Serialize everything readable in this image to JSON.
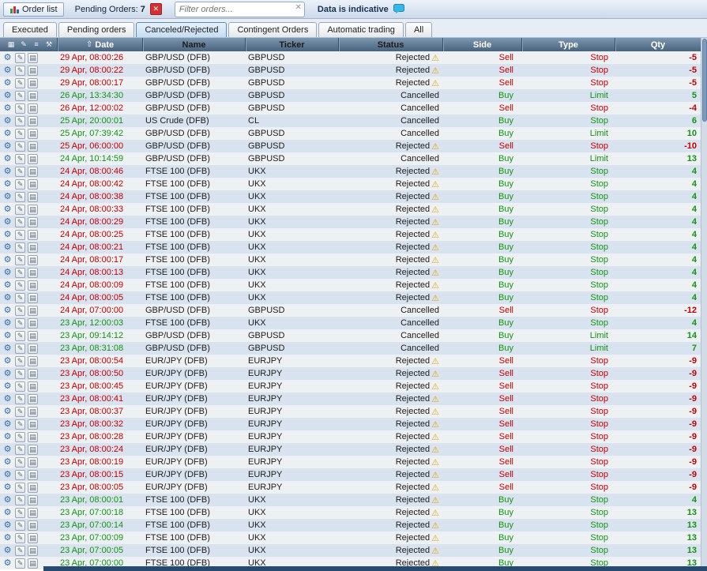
{
  "toolbar": {
    "order_list_label": "Order list",
    "pending_orders_label": "Pending Orders:",
    "pending_orders_count": "7",
    "filter_placeholder": "Filter orders...",
    "indicative_label": "Data is indicative"
  },
  "icons": {
    "close": "✕",
    "clear": "✕",
    "window": "▦",
    "edit": "✎",
    "list": "≡",
    "wrench": "⚒",
    "sort_asc": "⇧",
    "warning": "⚠",
    "settings": "⚙",
    "details": "▤"
  },
  "colors": {
    "red": "#c40000",
    "green": "#149314",
    "neutral": "#1c1c1c"
  },
  "tabs": [
    {
      "label": "Executed",
      "active": false
    },
    {
      "label": "Pending orders",
      "active": false
    },
    {
      "label": "Canceled/Rejected",
      "active": true
    },
    {
      "label": "Contingent Orders",
      "active": false
    },
    {
      "label": "Automatic trading",
      "active": false
    },
    {
      "label": "All",
      "active": false
    }
  ],
  "table": {
    "columns": {
      "date": "Date",
      "name": "Name",
      "ticker": "Ticker",
      "status": "Status",
      "side": "Side",
      "type": "Type",
      "qty": "Qty"
    },
    "rows": [
      {
        "date": "29 Apr, 08:00:26",
        "name": "GBP/USD (DFB)",
        "ticker": "GBPUSD",
        "status": "Rejected",
        "warning": true,
        "side": "Sell",
        "type": "Stop",
        "qty": "-5",
        "date_color": "red"
      },
      {
        "date": "29 Apr, 08:00:22",
        "name": "GBP/USD (DFB)",
        "ticker": "GBPUSD",
        "status": "Rejected",
        "warning": true,
        "side": "Sell",
        "type": "Stop",
        "qty": "-5",
        "date_color": "red"
      },
      {
        "date": "29 Apr, 08:00:17",
        "name": "GBP/USD (DFB)",
        "ticker": "GBPUSD",
        "status": "Rejected",
        "warning": true,
        "side": "Sell",
        "type": "Stop",
        "qty": "-5",
        "date_color": "red"
      },
      {
        "date": "26 Apr, 13:34:30",
        "name": "GBP/USD (DFB)",
        "ticker": "GBPUSD",
        "status": "Cancelled",
        "warning": false,
        "side": "Buy",
        "type": "Limit",
        "qty": "5",
        "date_color": "green"
      },
      {
        "date": "26 Apr, 12:00:02",
        "name": "GBP/USD (DFB)",
        "ticker": "GBPUSD",
        "status": "Cancelled",
        "warning": false,
        "side": "Sell",
        "type": "Stop",
        "qty": "-4",
        "date_color": "red"
      },
      {
        "date": "25 Apr, 20:00:01",
        "name": "US Crude (DFB)",
        "ticker": "CL",
        "status": "Cancelled",
        "warning": false,
        "side": "Buy",
        "type": "Stop",
        "qty": "6",
        "date_color": "green"
      },
      {
        "date": "25 Apr, 07:39:42",
        "name": "GBP/USD (DFB)",
        "ticker": "GBPUSD",
        "status": "Cancelled",
        "warning": false,
        "side": "Buy",
        "type": "Limit",
        "qty": "10",
        "date_color": "green"
      },
      {
        "date": "25 Apr, 06:00:00",
        "name": "GBP/USD (DFB)",
        "ticker": "GBPUSD",
        "status": "Rejected",
        "warning": true,
        "side": "Sell",
        "type": "Stop",
        "qty": "-10",
        "date_color": "red"
      },
      {
        "date": "24 Apr, 10:14:59",
        "name": "GBP/USD (DFB)",
        "ticker": "GBPUSD",
        "status": "Cancelled",
        "warning": false,
        "side": "Buy",
        "type": "Limit",
        "qty": "13",
        "date_color": "green"
      },
      {
        "date": "24 Apr, 08:00:46",
        "name": "FTSE 100 (DFB)",
        "ticker": "UKX",
        "status": "Rejected",
        "warning": true,
        "side": "Buy",
        "type": "Stop",
        "qty": "4",
        "date_color": "red"
      },
      {
        "date": "24 Apr, 08:00:42",
        "name": "FTSE 100 (DFB)",
        "ticker": "UKX",
        "status": "Rejected",
        "warning": true,
        "side": "Buy",
        "type": "Stop",
        "qty": "4",
        "date_color": "red"
      },
      {
        "date": "24 Apr, 08:00:38",
        "name": "FTSE 100 (DFB)",
        "ticker": "UKX",
        "status": "Rejected",
        "warning": true,
        "side": "Buy",
        "type": "Stop",
        "qty": "4",
        "date_color": "red"
      },
      {
        "date": "24 Apr, 08:00:33",
        "name": "FTSE 100 (DFB)",
        "ticker": "UKX",
        "status": "Rejected",
        "warning": true,
        "side": "Buy",
        "type": "Stop",
        "qty": "4",
        "date_color": "red"
      },
      {
        "date": "24 Apr, 08:00:29",
        "name": "FTSE 100 (DFB)",
        "ticker": "UKX",
        "status": "Rejected",
        "warning": true,
        "side": "Buy",
        "type": "Stop",
        "qty": "4",
        "date_color": "red"
      },
      {
        "date": "24 Apr, 08:00:25",
        "name": "FTSE 100 (DFB)",
        "ticker": "UKX",
        "status": "Rejected",
        "warning": true,
        "side": "Buy",
        "type": "Stop",
        "qty": "4",
        "date_color": "red"
      },
      {
        "date": "24 Apr, 08:00:21",
        "name": "FTSE 100 (DFB)",
        "ticker": "UKX",
        "status": "Rejected",
        "warning": true,
        "side": "Buy",
        "type": "Stop",
        "qty": "4",
        "date_color": "red"
      },
      {
        "date": "24 Apr, 08:00:17",
        "name": "FTSE 100 (DFB)",
        "ticker": "UKX",
        "status": "Rejected",
        "warning": true,
        "side": "Buy",
        "type": "Stop",
        "qty": "4",
        "date_color": "red"
      },
      {
        "date": "24 Apr, 08:00:13",
        "name": "FTSE 100 (DFB)",
        "ticker": "UKX",
        "status": "Rejected",
        "warning": true,
        "side": "Buy",
        "type": "Stop",
        "qty": "4",
        "date_color": "red"
      },
      {
        "date": "24 Apr, 08:00:09",
        "name": "FTSE 100 (DFB)",
        "ticker": "UKX",
        "status": "Rejected",
        "warning": true,
        "side": "Buy",
        "type": "Stop",
        "qty": "4",
        "date_color": "red"
      },
      {
        "date": "24 Apr, 08:00:05",
        "name": "FTSE 100 (DFB)",
        "ticker": "UKX",
        "status": "Rejected",
        "warning": true,
        "side": "Buy",
        "type": "Stop",
        "qty": "4",
        "date_color": "red"
      },
      {
        "date": "24 Apr, 07:00:00",
        "name": "GBP/USD (DFB)",
        "ticker": "GBPUSD",
        "status": "Cancelled",
        "warning": false,
        "side": "Sell",
        "type": "Stop",
        "qty": "-12",
        "date_color": "red"
      },
      {
        "date": "23 Apr, 12:00:03",
        "name": "FTSE 100 (DFB)",
        "ticker": "UKX",
        "status": "Cancelled",
        "warning": false,
        "side": "Buy",
        "type": "Stop",
        "qty": "4",
        "date_color": "green"
      },
      {
        "date": "23 Apr, 09:14:12",
        "name": "GBP/USD (DFB)",
        "ticker": "GBPUSD",
        "status": "Cancelled",
        "warning": false,
        "side": "Buy",
        "type": "Limit",
        "qty": "14",
        "date_color": "green"
      },
      {
        "date": "23 Apr, 08:31:08",
        "name": "GBP/USD (DFB)",
        "ticker": "GBPUSD",
        "status": "Cancelled",
        "warning": false,
        "side": "Buy",
        "type": "Limit",
        "qty": "7",
        "date_color": "green"
      },
      {
        "date": "23 Apr, 08:00:54",
        "name": "EUR/JPY (DFB)",
        "ticker": "EURJPY",
        "status": "Rejected",
        "warning": true,
        "side": "Sell",
        "type": "Stop",
        "qty": "-9",
        "date_color": "red"
      },
      {
        "date": "23 Apr, 08:00:50",
        "name": "EUR/JPY (DFB)",
        "ticker": "EURJPY",
        "status": "Rejected",
        "warning": true,
        "side": "Sell",
        "type": "Stop",
        "qty": "-9",
        "date_color": "red"
      },
      {
        "date": "23 Apr, 08:00:45",
        "name": "EUR/JPY (DFB)",
        "ticker": "EURJPY",
        "status": "Rejected",
        "warning": true,
        "side": "Sell",
        "type": "Stop",
        "qty": "-9",
        "date_color": "red"
      },
      {
        "date": "23 Apr, 08:00:41",
        "name": "EUR/JPY (DFB)",
        "ticker": "EURJPY",
        "status": "Rejected",
        "warning": true,
        "side": "Sell",
        "type": "Stop",
        "qty": "-9",
        "date_color": "red"
      },
      {
        "date": "23 Apr, 08:00:37",
        "name": "EUR/JPY (DFB)",
        "ticker": "EURJPY",
        "status": "Rejected",
        "warning": true,
        "side": "Sell",
        "type": "Stop",
        "qty": "-9",
        "date_color": "red"
      },
      {
        "date": "23 Apr, 08:00:32",
        "name": "EUR/JPY (DFB)",
        "ticker": "EURJPY",
        "status": "Rejected",
        "warning": true,
        "side": "Sell",
        "type": "Stop",
        "qty": "-9",
        "date_color": "red"
      },
      {
        "date": "23 Apr, 08:00:28",
        "name": "EUR/JPY (DFB)",
        "ticker": "EURJPY",
        "status": "Rejected",
        "warning": true,
        "side": "Sell",
        "type": "Stop",
        "qty": "-9",
        "date_color": "red"
      },
      {
        "date": "23 Apr, 08:00:24",
        "name": "EUR/JPY (DFB)",
        "ticker": "EURJPY",
        "status": "Rejected",
        "warning": true,
        "side": "Sell",
        "type": "Stop",
        "qty": "-9",
        "date_color": "red"
      },
      {
        "date": "23 Apr, 08:00:19",
        "name": "EUR/JPY (DFB)",
        "ticker": "EURJPY",
        "status": "Rejected",
        "warning": true,
        "side": "Sell",
        "type": "Stop",
        "qty": "-9",
        "date_color": "red"
      },
      {
        "date": "23 Apr, 08:00:15",
        "name": "EUR/JPY (DFB)",
        "ticker": "EURJPY",
        "status": "Rejected",
        "warning": true,
        "side": "Sell",
        "type": "Stop",
        "qty": "-9",
        "date_color": "red"
      },
      {
        "date": "23 Apr, 08:00:05",
        "name": "EUR/JPY (DFB)",
        "ticker": "EURJPY",
        "status": "Rejected",
        "warning": true,
        "side": "Sell",
        "type": "Stop",
        "qty": "-9",
        "date_color": "red"
      },
      {
        "date": "23 Apr, 08:00:01",
        "name": "FTSE 100 (DFB)",
        "ticker": "UKX",
        "status": "Rejected",
        "warning": true,
        "side": "Buy",
        "type": "Stop",
        "qty": "4",
        "date_color": "green"
      },
      {
        "date": "23 Apr, 07:00:18",
        "name": "FTSE 100 (DFB)",
        "ticker": "UKX",
        "status": "Rejected",
        "warning": true,
        "side": "Buy",
        "type": "Stop",
        "qty": "13",
        "date_color": "green"
      },
      {
        "date": "23 Apr, 07:00:14",
        "name": "FTSE 100 (DFB)",
        "ticker": "UKX",
        "status": "Rejected",
        "warning": true,
        "side": "Buy",
        "type": "Stop",
        "qty": "13",
        "date_color": "green"
      },
      {
        "date": "23 Apr, 07:00:09",
        "name": "FTSE 100 (DFB)",
        "ticker": "UKX",
        "status": "Rejected",
        "warning": true,
        "side": "Buy",
        "type": "Stop",
        "qty": "13",
        "date_color": "green"
      },
      {
        "date": "23 Apr, 07:00:05",
        "name": "FTSE 100 (DFB)",
        "ticker": "UKX",
        "status": "Rejected",
        "warning": true,
        "side": "Buy",
        "type": "Stop",
        "qty": "13",
        "date_color": "green"
      },
      {
        "date": "23 Apr, 07:00:00",
        "name": "FTSE 100 (DFB)",
        "ticker": "UKX",
        "status": "Rejected",
        "warning": true,
        "side": "Buy",
        "type": "Stop",
        "qty": "13",
        "date_color": "green"
      }
    ]
  }
}
